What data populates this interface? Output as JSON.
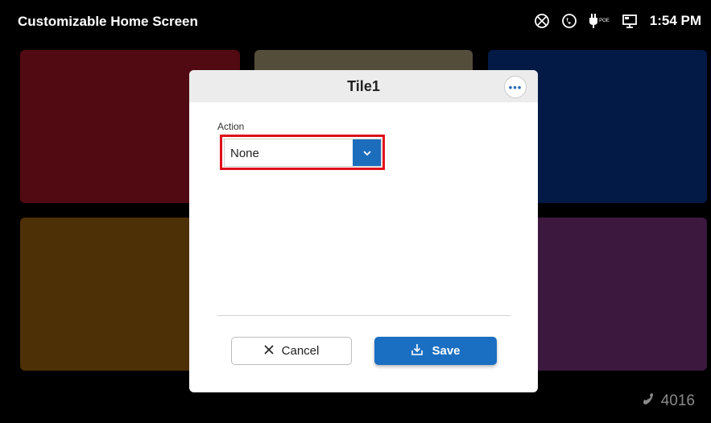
{
  "statusbar": {
    "title": "Customizable Home Screen",
    "time": "1:54 PM",
    "icons": [
      "no-network-icon",
      "phone-icon",
      "poe-plug-icon",
      "display-icon"
    ],
    "poe_label": "POE"
  },
  "tiles": [
    {
      "name": "tile-red",
      "color": "#c0182b"
    },
    {
      "name": "tile-olive",
      "color": "#c9b78a"
    },
    {
      "name": "tile-blue",
      "color": "#0a3fa8"
    },
    {
      "name": "tile-orange",
      "color": "#b87410"
    },
    {
      "name": "tile-purple",
      "color": "#8f3a94"
    }
  ],
  "extension": {
    "number": "4016",
    "icon": "phone-handset-icon"
  },
  "dialog": {
    "title": "Tile1",
    "more_icon": "more-dots-icon",
    "action_label": "Action",
    "action_value": "None",
    "cancel_label": "Cancel",
    "save_label": "Save",
    "accent_color": "#1d6dbd",
    "highlight_color": "#e0101a"
  }
}
